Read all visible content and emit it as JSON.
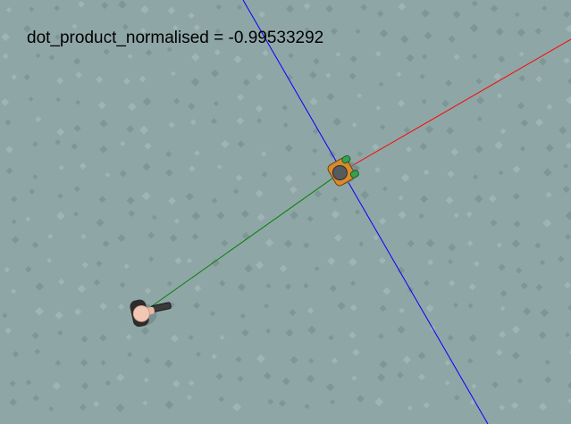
{
  "readout": {
    "label": "dot_product_normalised",
    "separator": " = ",
    "value": "-0.99533292"
  },
  "scene": {
    "background_color": "#8fa6a6",
    "tile_mark_color": "#7f9696",
    "tile_highlight_color": "#9fb5b5",
    "vectors": [
      {
        "name": "target-direction-vector",
        "color": "#008000"
      },
      {
        "name": "facing-direction-vector",
        "color": "#ff0000"
      },
      {
        "name": "perpendicular-axis-line",
        "color": "#0000ff"
      }
    ],
    "characters": [
      {
        "name": "enemy-soldier",
        "icon": "orange-armored-topdown-character"
      },
      {
        "name": "player-character",
        "icon": "bald-gunman-topdown-character"
      }
    ]
  }
}
